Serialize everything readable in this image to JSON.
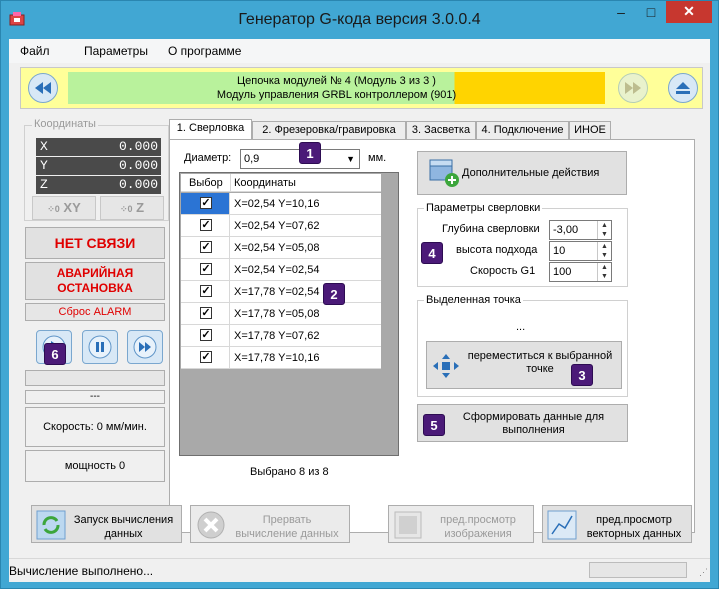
{
  "window": {
    "title": "Генератор G-кода версия 3.0.0.4",
    "minimize": "–",
    "maximize": "□",
    "close": "✕"
  },
  "menu": [
    "Файл",
    "Параметры",
    "О программе"
  ],
  "chain": {
    "line1": "Цепочка модулей № 4 (Модуль 3 из 3 )",
    "line2": "Модуль управления GRBL контроллером (901)"
  },
  "coords": {
    "label": "Координаты",
    "rows": [
      {
        "axis": "X",
        "value": "0.000"
      },
      {
        "axis": "Y",
        "value": "0.000"
      },
      {
        "axis": "Z",
        "value": "0.000"
      }
    ],
    "zero_xy": "XY",
    "zero_z": "Z"
  },
  "connection": "НЕТ СВЯЗИ",
  "emergency": "АВАРИЙНАЯ ОСТАНОВКА",
  "reset_alarm": "Сброс ALARM",
  "status_line": "---",
  "speed": "Скорость: 0 мм/мин.",
  "power": "мощность 0",
  "tabs": [
    "1. Сверловка",
    "2. Фрезеровка/гравировка",
    "3. Засветка",
    "4. Подключение",
    "ИНОЕ"
  ],
  "diameter": {
    "label": "Диаметр:",
    "value": "0,9",
    "unit": "мм."
  },
  "table": {
    "headers": [
      "Выбор",
      "Координаты"
    ],
    "rows": [
      "X=02,54 Y=10,16",
      "X=02,54 Y=07,62",
      "X=02,54 Y=05,08",
      "X=02,54 Y=02,54",
      "X=17,78 Y=02,54",
      "X=17,78 Y=05,08",
      "X=17,78 Y=07,62",
      "X=17,78 Y=10,16"
    ],
    "selected_summary": "Выбрано 8 из 8"
  },
  "extra_actions": "Дополнительные действия",
  "drill_params": {
    "label": "Параметры сверловки",
    "depth_label": "Глубина сверловки",
    "depth_value": "-3,00",
    "approach_label": "высота подхода",
    "approach_value": "10",
    "speed_label": "Скорость G1",
    "speed_value": "100"
  },
  "point": {
    "label": "Выделенная точка",
    "value": "...",
    "move_button": "переместиться к выбранной точке"
  },
  "generate_button": "Сформировать данные для выполнения",
  "bottom": {
    "start_calc": "Запуск вычисления данных",
    "abort_calc": "Прервать вычисление данных",
    "preview_image": "пред.просмотр изображения",
    "preview_vector": "пред.просмотр векторных данных"
  },
  "status": "Вычисление выполнено...",
  "badges": [
    "1",
    "2",
    "3",
    "4",
    "5",
    "6"
  ]
}
